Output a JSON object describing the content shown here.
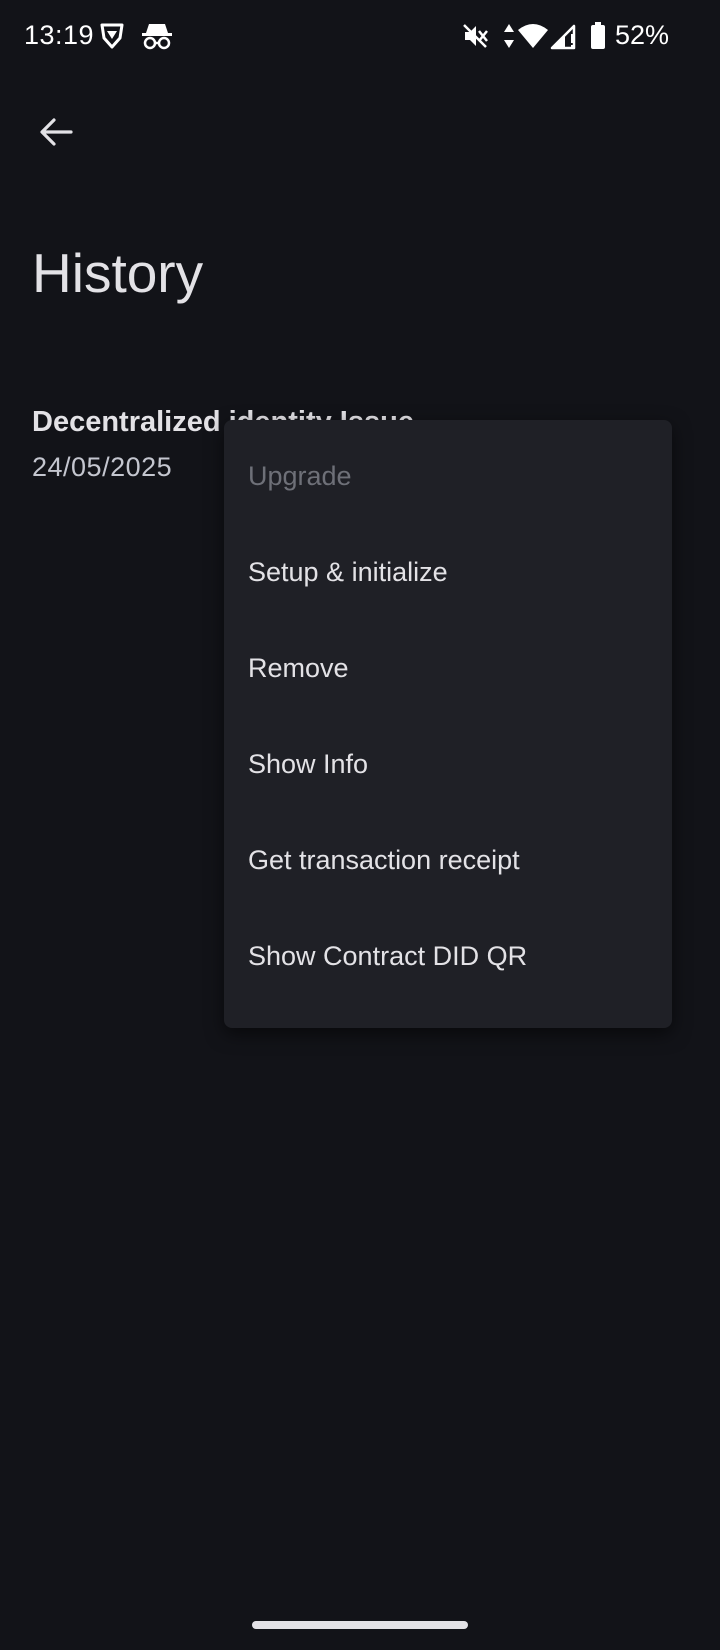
{
  "status_bar": {
    "time": "13:19",
    "battery": "52%",
    "icons": [
      "brave-icon",
      "incognito-icon",
      "mute-icon",
      "data-arrows-icon",
      "wifi-icon",
      "signal-icon",
      "battery-icon"
    ]
  },
  "header": {
    "back_icon": "arrow-left-icon",
    "title": "History"
  },
  "history": {
    "items": [
      {
        "title": "Decentralized identity Issue",
        "date": "24/05/2025"
      }
    ]
  },
  "menu": {
    "items": [
      {
        "label": "Upgrade",
        "disabled": true
      },
      {
        "label": "Setup & initialize",
        "disabled": false
      },
      {
        "label": "Remove",
        "disabled": false
      },
      {
        "label": "Show Info",
        "disabled": false
      },
      {
        "label": "Get transaction receipt",
        "disabled": false
      },
      {
        "label": "Show Contract DID QR",
        "disabled": false
      }
    ]
  },
  "colors": {
    "background": "#121318",
    "menu_background": "#1f2026",
    "text_primary": "#e3e2e6",
    "text_disabled": "#6e7078"
  }
}
